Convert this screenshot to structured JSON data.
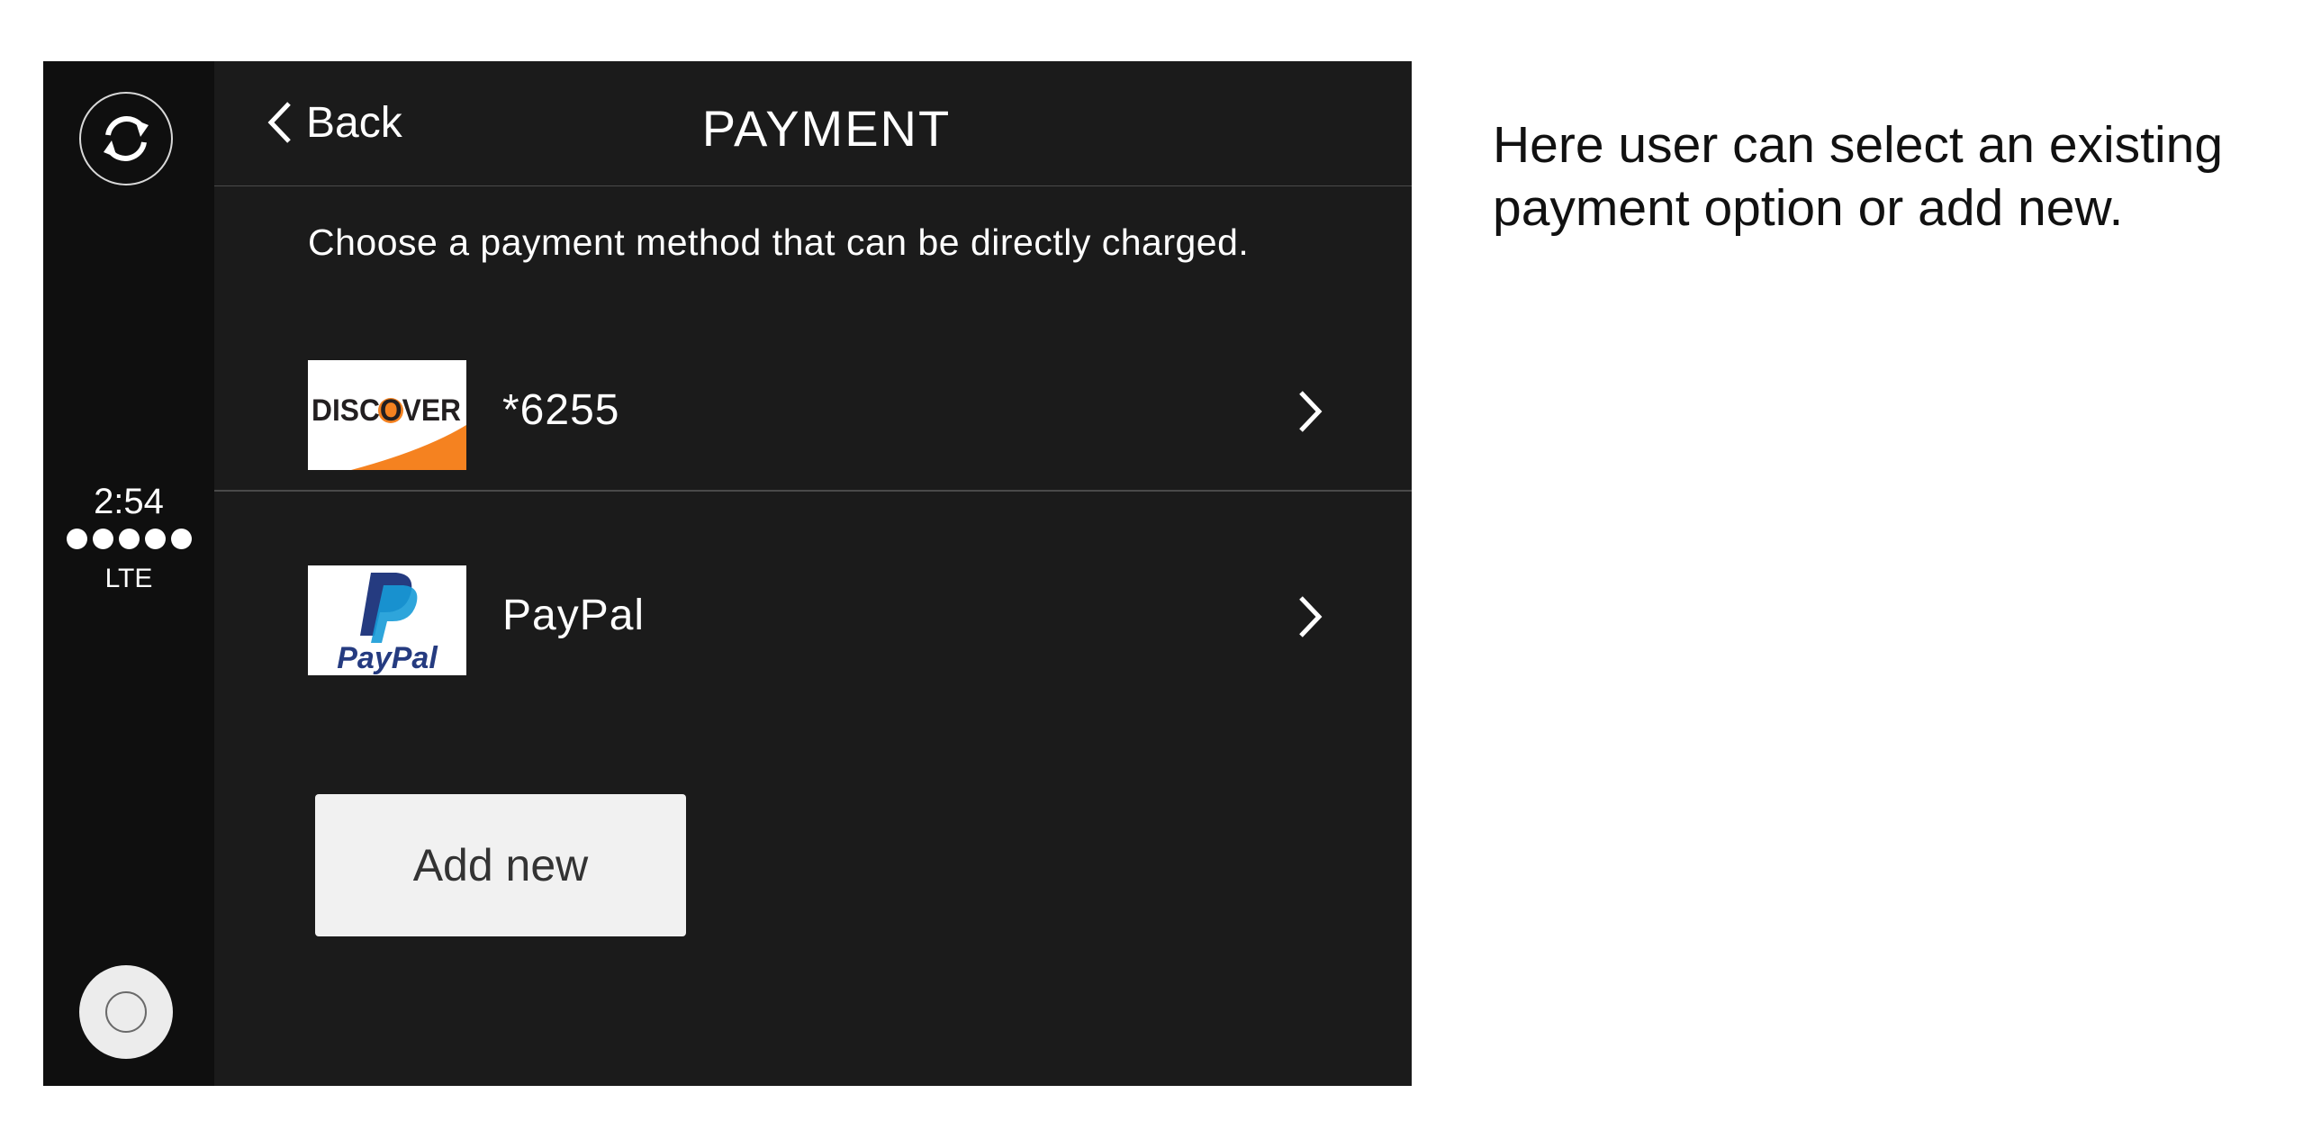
{
  "header": {
    "back_label": "Back",
    "title": "PAYMENT"
  },
  "subtitle": "Choose a payment method that can be directly charged.",
  "payment_methods": [
    {
      "label": "*6255",
      "logo": "discover-logo",
      "logo_text": "DISCOVER",
      "icon": "chevron-right-icon"
    },
    {
      "label": "PayPal",
      "logo": "paypal-logo",
      "logo_text": "PayPal",
      "icon": "chevron-right-icon"
    }
  ],
  "add_button_label": "Add new",
  "status": {
    "time": "2:54",
    "network": "LTE",
    "signal_bars": 5
  },
  "sidebar": {
    "top_icon": "refresh-icon",
    "bottom_icon": "home-button"
  },
  "annotation": "Here user can select an existing payment option or add new.",
  "colors": {
    "background": "#1b1b1b",
    "sidebar": "#0f0f0f",
    "text": "#ffffff",
    "button": "#f1f1f1",
    "discover_orange": "#f58220",
    "paypal_dark_blue": "#253b80",
    "paypal_light_blue": "#179bd7"
  }
}
